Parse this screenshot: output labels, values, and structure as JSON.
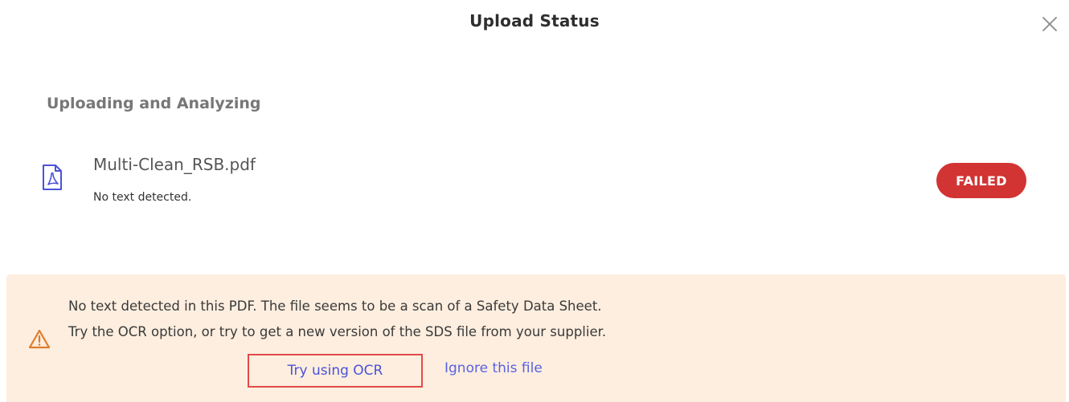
{
  "dialog": {
    "title": "Upload Status",
    "close_icon": "close-icon"
  },
  "upload": {
    "section_title": "Uploading and Analyzing",
    "file": {
      "icon": "pdf-file-icon",
      "name": "Multi-Clean_RSB.pdf",
      "status_text": "No text detected.",
      "badge": "FAILED"
    }
  },
  "alert": {
    "icon": "warning-icon",
    "line1": "No text detected in this PDF. The file seems to be a scan of a Safety Data Sheet.",
    "line2": "Try the OCR option, or try to get a new version of the SDS file from your supplier.",
    "ocr_link": "Try using OCR",
    "ignore_link": "Ignore this file"
  },
  "colors": {
    "failed_badge": "#d23333",
    "alert_background": "#fdeedf",
    "link": "#5a62e0",
    "warning": "#e07b2a",
    "pdf_icon": "#4b52d8"
  }
}
